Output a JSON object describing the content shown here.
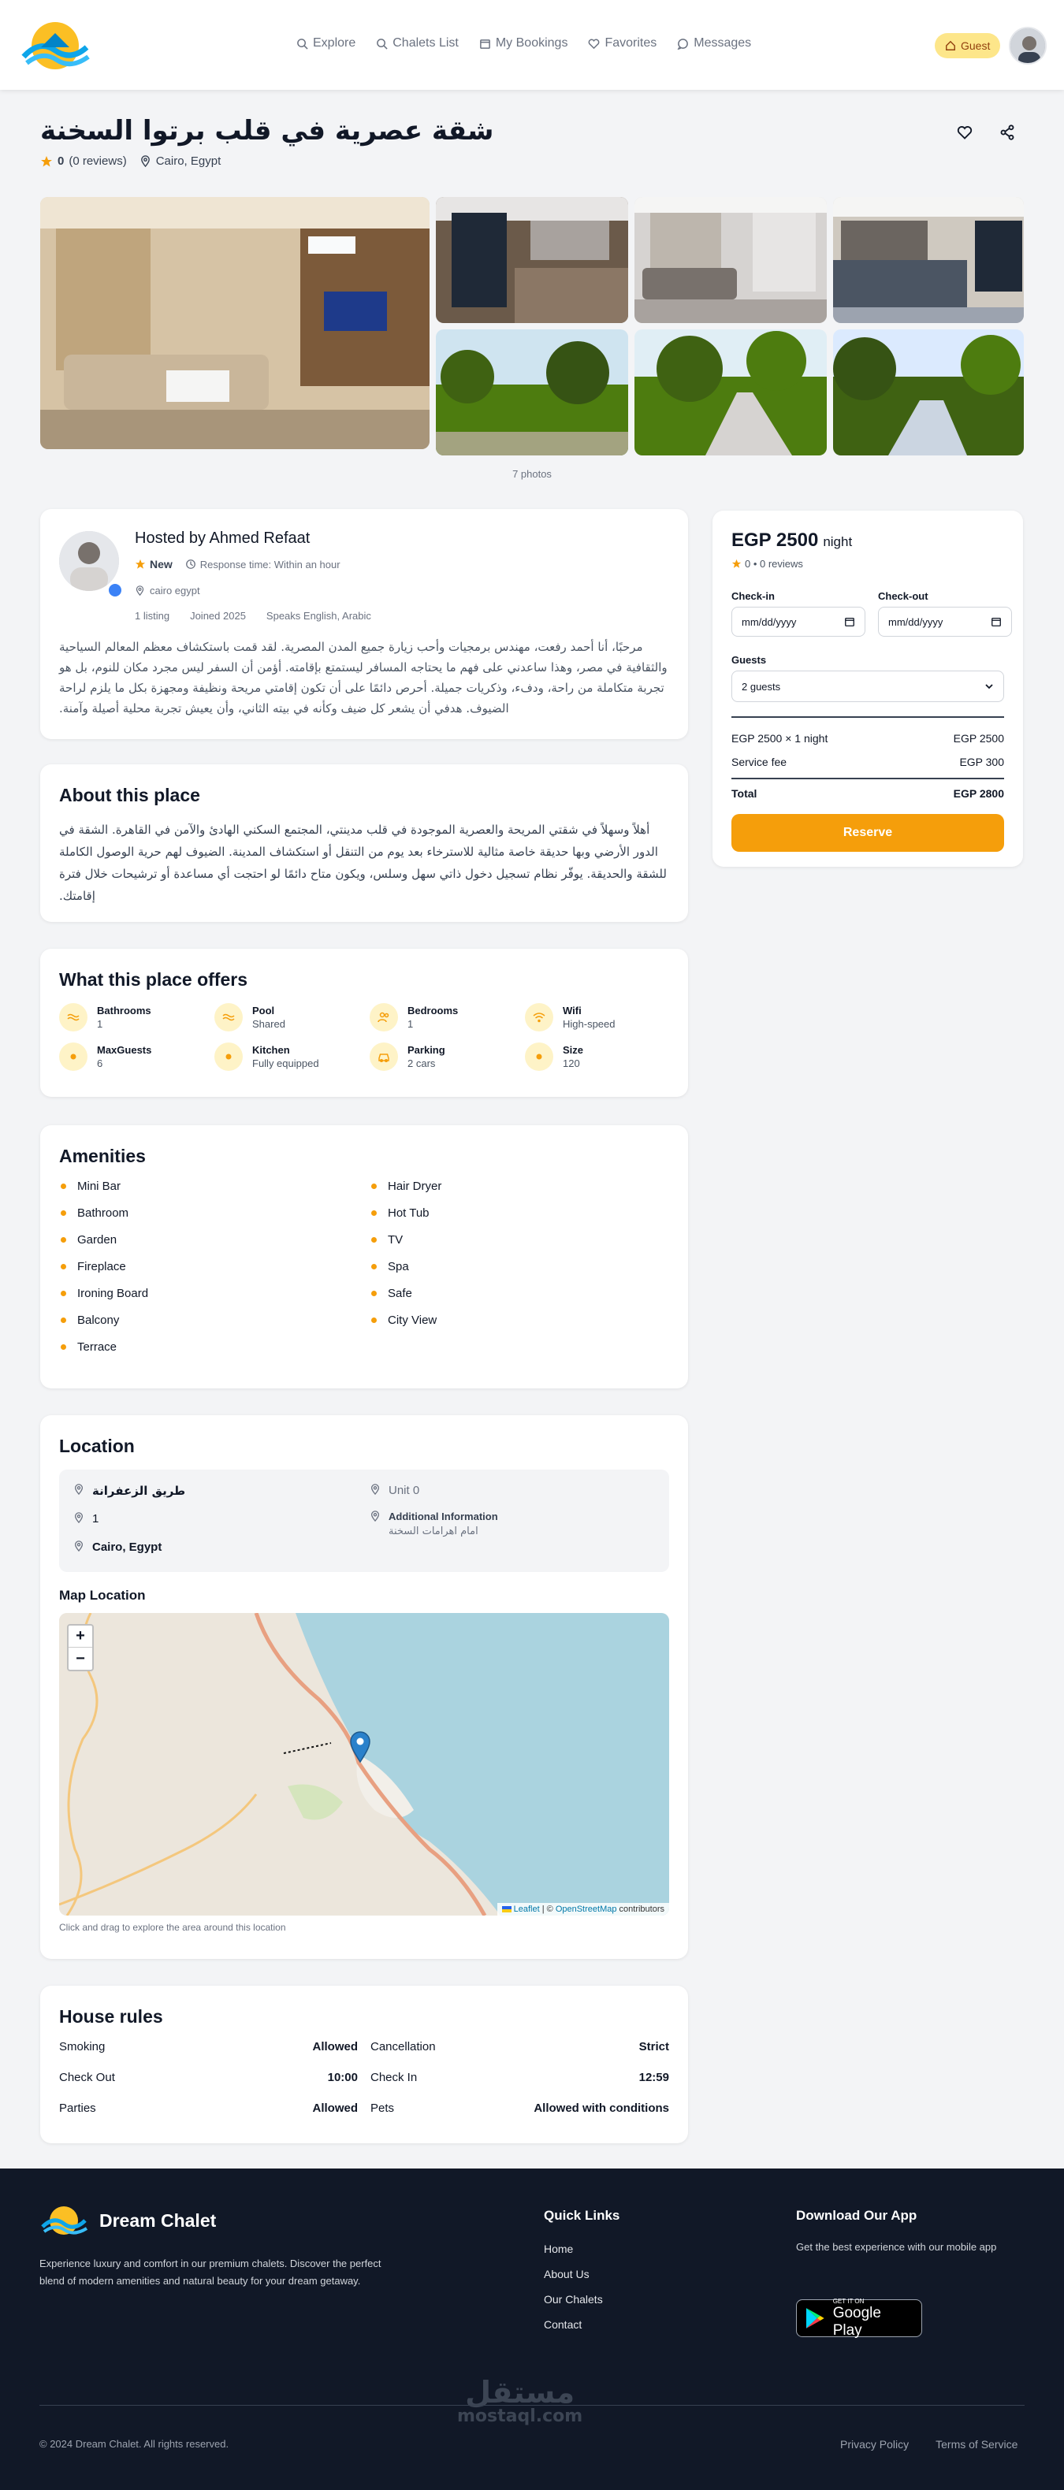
{
  "nav": {
    "links": [
      {
        "label": "Explore",
        "icon": "search-icon"
      },
      {
        "label": "Chalets List",
        "icon": "search-icon"
      },
      {
        "label": "My Bookings",
        "icon": "calendar-icon"
      },
      {
        "label": "Favorites",
        "icon": "heart-icon"
      },
      {
        "label": "Messages",
        "icon": "message-icon"
      }
    ],
    "guest_label": "Guest",
    "accent": "#f59e0b"
  },
  "listing": {
    "title": "شقة عصرية في قلب برتوا السخنة",
    "rating": "0",
    "reviews": "(0 reviews)",
    "location": "Cairo, Egypt",
    "photo_count": "7 photos"
  },
  "host": {
    "name": "Hosted by Ahmed Refaat",
    "status": "New",
    "response": "Response time: Within an hour",
    "city": "cairo egypt",
    "listings": "1 listing",
    "joined": "Joined 2025",
    "languages": "Speaks English, Arabic",
    "bio": "مرحبًا، أنا أحمد رفعت، مهندس برمجيات وأحب زيارة جميع المدن المصرية. لقد قمت باستكشاف معظم المعالم السياحية والثقافية في مصر، وهذا ساعدني على فهم ما يحتاجه المسافر ليستمتع بإقامته. أؤمن أن السفر ليس مجرد مكان للنوم، بل هو تجربة متكاملة من راحة، ودفء، وذكريات جميلة. أحرص دائمًا على أن تكون إقامتي مريحة ونظيفة ومجهزة بكل ما يلزم لراحة الضيوف. هدفي أن يشعر كل ضيف وكأنه في بيته الثاني، وأن يعيش تجربة محلية أصيلة وآمنة."
  },
  "booking": {
    "price": "EGP 2500",
    "unit": "night",
    "rating_line": "0 • 0 reviews",
    "checkin_label": "Check-in",
    "checkout_label": "Check-out",
    "date_placeholder": "mm/dd/yyyy",
    "guests_label": "Guests",
    "guests_value": "2 guests",
    "nights_line": "EGP 2500 × 1 night",
    "nights_value": "EGP 2500",
    "service_label": "Service fee",
    "service_value": "EGP 300",
    "total_label": "Total",
    "total_value": "EGP 2800",
    "reserve": "Reserve"
  },
  "about": {
    "heading": "About this place",
    "text": "أهلاً وسهلاً في شقتي المريحة والعصرية الموجودة في قلب مدينتي، المجتمع السكني الهادئ والآمن في القاهرة. الشقة في الدور الأرضي وبها حديقة خاصة مثالية للاسترخاء بعد يوم من التنقل أو استكشاف المدينة. الضيوف لهم حرية الوصول الكاملة للشقة والحديقة. يوفّر نظام تسجيل دخول ذاتي سهل وسلس، ويكون متاح دائمًا لو احتجت أي مساعدة أو ترشيحات خلال فترة إقامتك."
  },
  "offers": {
    "heading": "What this place offers",
    "items": [
      {
        "title": "Bathrooms",
        "sub": "1",
        "icon": "waves-icon"
      },
      {
        "title": "Pool",
        "sub": "Shared",
        "icon": "waves-icon"
      },
      {
        "title": "Bedrooms",
        "sub": "1",
        "icon": "users-icon"
      },
      {
        "title": "Wifi",
        "sub": "High-speed",
        "icon": "wifi-icon"
      },
      {
        "title": "MaxGuests",
        "sub": "6",
        "icon": "dot-icon"
      },
      {
        "title": "Kitchen",
        "sub": "Fully equipped",
        "icon": "dot-icon"
      },
      {
        "title": "Parking",
        "sub": "2 cars",
        "icon": "car-icon"
      },
      {
        "title": "Size",
        "sub": "120",
        "icon": "dot-icon"
      }
    ]
  },
  "amenities": {
    "heading": "Amenities",
    "items": [
      "Mini Bar",
      "Hair Dryer",
      "Bathroom",
      "Hot Tub",
      "Garden",
      "TV",
      "Fireplace",
      "Spa",
      "Ironing Board",
      "Safe",
      "Balcony",
      "City View",
      "Terrace"
    ]
  },
  "location": {
    "heading": "Location",
    "street": "طريق الزعفرانة",
    "number": "1",
    "city": "Cairo, Egypt",
    "unit": "Unit 0",
    "additional_label": "Additional Information",
    "additional_value": "امام اهرامات السخنة",
    "map_heading": "Map Location",
    "zoom_in": "+",
    "zoom_out": "−",
    "attribution_leaflet": "Leaflet",
    "attribution_sep": " | © ",
    "attribution_osm": "OpenStreetMap",
    "attribution_end": " contributors",
    "map_hint": "Click and drag to explore the area around this location"
  },
  "rules": {
    "heading": "House rules",
    "items": [
      {
        "label": "Smoking",
        "value": "Allowed"
      },
      {
        "label": "Cancellation",
        "value": "Strict"
      },
      {
        "label": "Check Out",
        "value": "10:00"
      },
      {
        "label": "Check In",
        "value": "12:59"
      },
      {
        "label": "Parties",
        "value": "Allowed"
      },
      {
        "label": "Pets",
        "value": "Allowed with conditions"
      }
    ]
  },
  "footer": {
    "brand": "Dream Chalet",
    "description": "Experience luxury and comfort in our premium chalets. Discover the perfect blend of modern amenities and natural beauty for your dream getaway.",
    "links_heading": "Quick Links",
    "links": [
      "Home",
      "About Us",
      "Our Chalets",
      "Contact"
    ],
    "app_heading": "Download Our App",
    "app_text": "Get the best experience with our mobile app",
    "store_small": "GET IT ON",
    "store_big": "Google Play",
    "copyright": "© 2024 Dream Chalet. All rights reserved.",
    "privacy": "Privacy Policy",
    "terms": "Terms of Service",
    "watermark": "مستقل",
    "watermark_sub": "mostaql.com"
  }
}
